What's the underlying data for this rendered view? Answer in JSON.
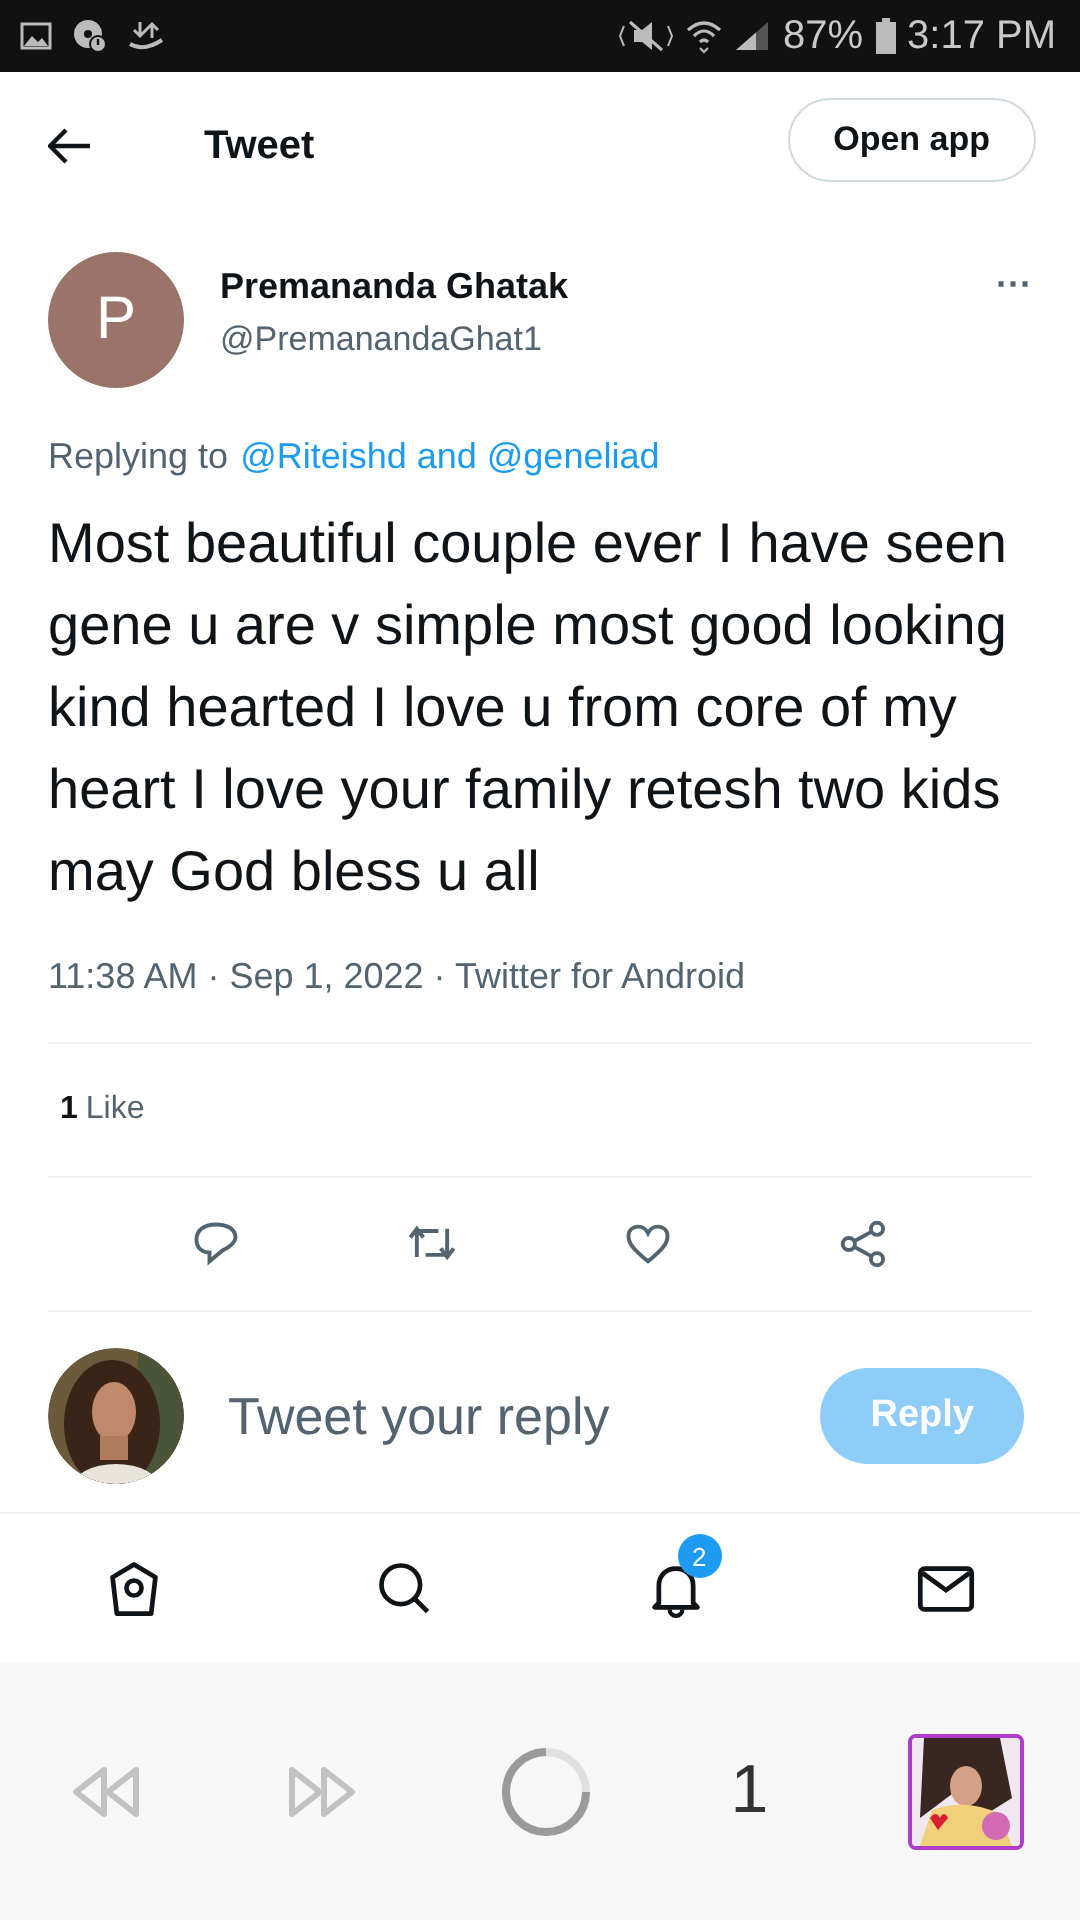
{
  "status_bar": {
    "battery": "87%",
    "time": "3:17 PM"
  },
  "header": {
    "title": "Tweet",
    "open_app": "Open app"
  },
  "tweet": {
    "author_initial": "P",
    "author_name": "Premananda Ghatak",
    "handle": "@PremanandaGhat1",
    "more": "···",
    "replying_prefix": "Replying to",
    "replying_to": "@Riteishd and @geneliad",
    "text": "Most beautiful couple ever I have seen gene u are v simple most good looking kind hearted I love u from core of my heart I love your family retesh two kids may God bless u all",
    "meta": "11:38 AM · Sep 1, 2022 · Twitter for Android",
    "likes_count": "1",
    "likes_label": "Like"
  },
  "actions": [
    {
      "kind": "reply"
    },
    {
      "kind": "retweet"
    },
    {
      "kind": "like"
    },
    {
      "kind": "share"
    }
  ],
  "reply_box": {
    "placeholder": "Tweet your reply",
    "button": "Reply",
    "disabled": true
  },
  "bottom_nav": [
    {
      "kind": "home"
    },
    {
      "kind": "search"
    },
    {
      "kind": "notifications",
      "badge": "2"
    },
    {
      "kind": "messages"
    }
  ],
  "browser_bar": {
    "tab_count": "1"
  }
}
